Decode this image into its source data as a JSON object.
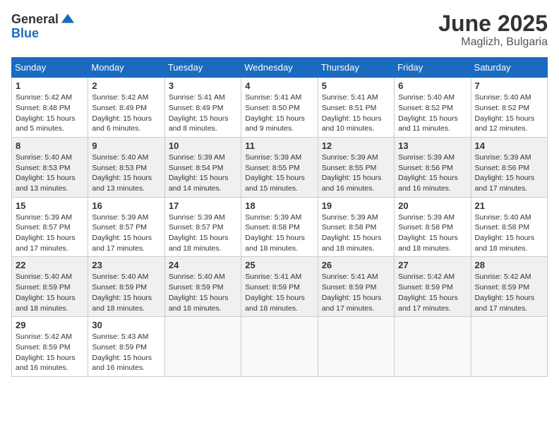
{
  "header": {
    "logo_general": "General",
    "logo_blue": "Blue",
    "month": "June 2025",
    "location": "Maglizh, Bulgaria"
  },
  "days_of_week": [
    "Sunday",
    "Monday",
    "Tuesday",
    "Wednesday",
    "Thursday",
    "Friday",
    "Saturday"
  ],
  "weeks": [
    [
      {
        "day": 1,
        "sunrise": "5:42 AM",
        "sunset": "8:48 PM",
        "daylight": "15 hours and 5 minutes."
      },
      {
        "day": 2,
        "sunrise": "5:42 AM",
        "sunset": "8:49 PM",
        "daylight": "15 hours and 6 minutes."
      },
      {
        "day": 3,
        "sunrise": "5:41 AM",
        "sunset": "8:49 PM",
        "daylight": "15 hours and 8 minutes."
      },
      {
        "day": 4,
        "sunrise": "5:41 AM",
        "sunset": "8:50 PM",
        "daylight": "15 hours and 9 minutes."
      },
      {
        "day": 5,
        "sunrise": "5:41 AM",
        "sunset": "8:51 PM",
        "daylight": "15 hours and 10 minutes."
      },
      {
        "day": 6,
        "sunrise": "5:40 AM",
        "sunset": "8:52 PM",
        "daylight": "15 hours and 11 minutes."
      },
      {
        "day": 7,
        "sunrise": "5:40 AM",
        "sunset": "8:52 PM",
        "daylight": "15 hours and 12 minutes."
      }
    ],
    [
      {
        "day": 8,
        "sunrise": "5:40 AM",
        "sunset": "8:53 PM",
        "daylight": "15 hours and 13 minutes."
      },
      {
        "day": 9,
        "sunrise": "5:40 AM",
        "sunset": "8:53 PM",
        "daylight": "15 hours and 13 minutes."
      },
      {
        "day": 10,
        "sunrise": "5:39 AM",
        "sunset": "8:54 PM",
        "daylight": "15 hours and 14 minutes."
      },
      {
        "day": 11,
        "sunrise": "5:39 AM",
        "sunset": "8:55 PM",
        "daylight": "15 hours and 15 minutes."
      },
      {
        "day": 12,
        "sunrise": "5:39 AM",
        "sunset": "8:55 PM",
        "daylight": "15 hours and 16 minutes."
      },
      {
        "day": 13,
        "sunrise": "5:39 AM",
        "sunset": "8:56 PM",
        "daylight": "15 hours and 16 minutes."
      },
      {
        "day": 14,
        "sunrise": "5:39 AM",
        "sunset": "8:56 PM",
        "daylight": "15 hours and 17 minutes."
      }
    ],
    [
      {
        "day": 15,
        "sunrise": "5:39 AM",
        "sunset": "8:57 PM",
        "daylight": "15 hours and 17 minutes."
      },
      {
        "day": 16,
        "sunrise": "5:39 AM",
        "sunset": "8:57 PM",
        "daylight": "15 hours and 17 minutes."
      },
      {
        "day": 17,
        "sunrise": "5:39 AM",
        "sunset": "8:57 PM",
        "daylight": "15 hours and 18 minutes."
      },
      {
        "day": 18,
        "sunrise": "5:39 AM",
        "sunset": "8:58 PM",
        "daylight": "15 hours and 18 minutes."
      },
      {
        "day": 19,
        "sunrise": "5:39 AM",
        "sunset": "8:58 PM",
        "daylight": "15 hours and 18 minutes."
      },
      {
        "day": 20,
        "sunrise": "5:39 AM",
        "sunset": "8:58 PM",
        "daylight": "15 hours and 18 minutes."
      },
      {
        "day": 21,
        "sunrise": "5:40 AM",
        "sunset": "8:58 PM",
        "daylight": "15 hours and 18 minutes."
      }
    ],
    [
      {
        "day": 22,
        "sunrise": "5:40 AM",
        "sunset": "8:59 PM",
        "daylight": "15 hours and 18 minutes."
      },
      {
        "day": 23,
        "sunrise": "5:40 AM",
        "sunset": "8:59 PM",
        "daylight": "15 hours and 18 minutes."
      },
      {
        "day": 24,
        "sunrise": "5:40 AM",
        "sunset": "8:59 PM",
        "daylight": "15 hours and 18 minutes."
      },
      {
        "day": 25,
        "sunrise": "5:41 AM",
        "sunset": "8:59 PM",
        "daylight": "15 hours and 18 minutes."
      },
      {
        "day": 26,
        "sunrise": "5:41 AM",
        "sunset": "8:59 PM",
        "daylight": "15 hours and 17 minutes."
      },
      {
        "day": 27,
        "sunrise": "5:42 AM",
        "sunset": "8:59 PM",
        "daylight": "15 hours and 17 minutes."
      },
      {
        "day": 28,
        "sunrise": "5:42 AM",
        "sunset": "8:59 PM",
        "daylight": "15 hours and 17 minutes."
      }
    ],
    [
      {
        "day": 29,
        "sunrise": "5:42 AM",
        "sunset": "8:59 PM",
        "daylight": "15 hours and 16 minutes."
      },
      {
        "day": 30,
        "sunrise": "5:43 AM",
        "sunset": "8:59 PM",
        "daylight": "15 hours and 16 minutes."
      },
      null,
      null,
      null,
      null,
      null
    ]
  ]
}
